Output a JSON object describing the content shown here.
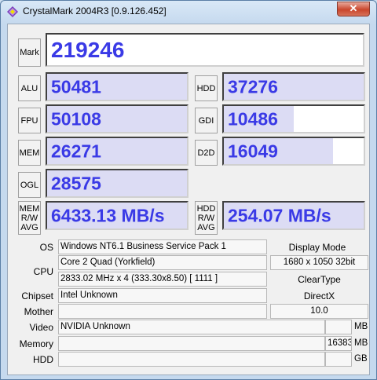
{
  "window": {
    "title": "CrystalMark 2004R3 [0.9.126.452]",
    "close_glyph": "✕"
  },
  "labels": {
    "mark": "Mark",
    "alu": "ALU",
    "fpu": "FPU",
    "mem": "MEM",
    "ogl": "OGL",
    "hdd": "HDD",
    "gdi": "GDI",
    "d2d": "D2D",
    "mem_rw_avg": [
      "MEM",
      "R/W",
      "AVG"
    ],
    "hdd_rw_avg": [
      "HDD",
      "R/W",
      "AVG"
    ]
  },
  "scores": {
    "mark": "219246",
    "alu": "50481",
    "fpu": "50108",
    "mem": "26271",
    "ogl": "28575",
    "hdd": "37276",
    "gdi": "10486",
    "d2d": "16049",
    "mem_rw": "6433.13 MB/s",
    "hdd_rw": "254.07 MB/s"
  },
  "score_fill_fraction": {
    "gdi": 0.5,
    "d2d": 0.78
  },
  "sysinfo": {
    "os_label": "OS",
    "os": "Windows NT6.1 Business Service Pack 1",
    "cpu_label": "CPU",
    "cpu_name": "Core 2 Quad (Yorkfield)",
    "cpu_clock": "2833.02 MHz x 4 (333.30x8.50) [ 1111 ]",
    "chipset_label": "Chipset",
    "chipset": "Intel Unknown",
    "mother_label": "Mother",
    "mother": "",
    "video_label": "Video",
    "video": "NVIDIA Unknown",
    "video_mb": "",
    "video_unit": "MB",
    "memory_label": "Memory",
    "memory": "",
    "memory_mb": "16383",
    "memory_unit": "MB",
    "hdd_label": "HDD",
    "hdd": "",
    "hdd_gb": "",
    "hdd_unit": "GB",
    "display_mode_label": "Display Mode",
    "display_mode": "1680 x 1050 32bit",
    "cleartype_label": "ClearType",
    "cleartype": "",
    "directx_label": "DirectX",
    "directx": "10.0"
  },
  "colors": {
    "score_text": "#3a3ae6",
    "score_fill": "#dcdcf4"
  }
}
